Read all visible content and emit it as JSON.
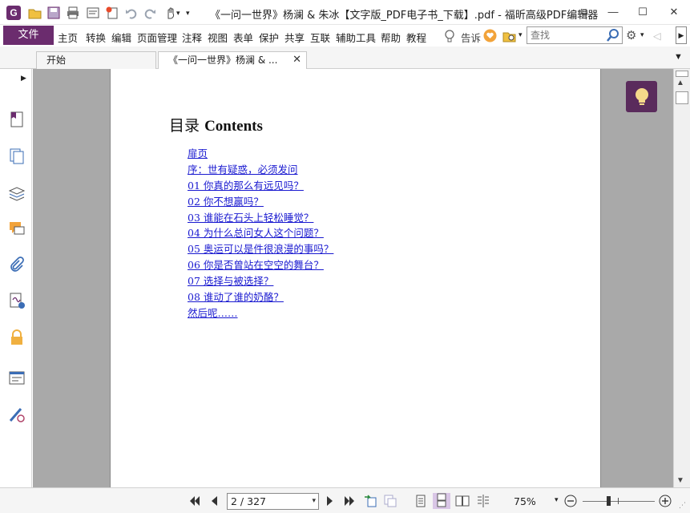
{
  "window": {
    "title": "《一问一世界》杨澜 & 朱冰【文字版_PDF电子书_下载】.pdf - 福昕高级PDF编辑器",
    "app_logo_letter": "G",
    "controls": {
      "restore": "⧉",
      "minimize": "—",
      "maximize": "☐",
      "close": "✕"
    }
  },
  "menu": {
    "file_label": "文件",
    "items": [
      "主页",
      "转换",
      "编辑",
      "页面管理",
      "注释",
      "视图",
      "表单",
      "保护",
      "共享",
      "互联",
      "辅助工具",
      "帮助",
      "教程"
    ],
    "tell_label": "告诉",
    "search_placeholder": "查找"
  },
  "tabs": [
    {
      "label": "开始",
      "active": false
    },
    {
      "label": "《一问一世界》杨澜 & ...",
      "active": true
    }
  ],
  "document": {
    "toc_heading_cn": "目录",
    "toc_heading_en": "Contents",
    "toc_items": [
      "扉页",
      "序：世有疑惑，必须发问",
      "01 你真的那么有远见吗？",
      "02 你不想赢吗？",
      "03 谁能在石头上轻松睡觉？",
      "04 为什么总问女人这个问题？",
      "05 奥运可以是件很浪漫的事吗？",
      "06 你是否曾站在空空的舞台？",
      "07 选择与被选择？",
      "08 谁动了谁的奶酪？",
      "然后呢……"
    ]
  },
  "status": {
    "page_indicator": "2 / 327",
    "zoom": "75%"
  },
  "colors": {
    "brand": "#6b2c6e",
    "link": "#1a1ad0",
    "doc_background": "#a9a9a9"
  }
}
